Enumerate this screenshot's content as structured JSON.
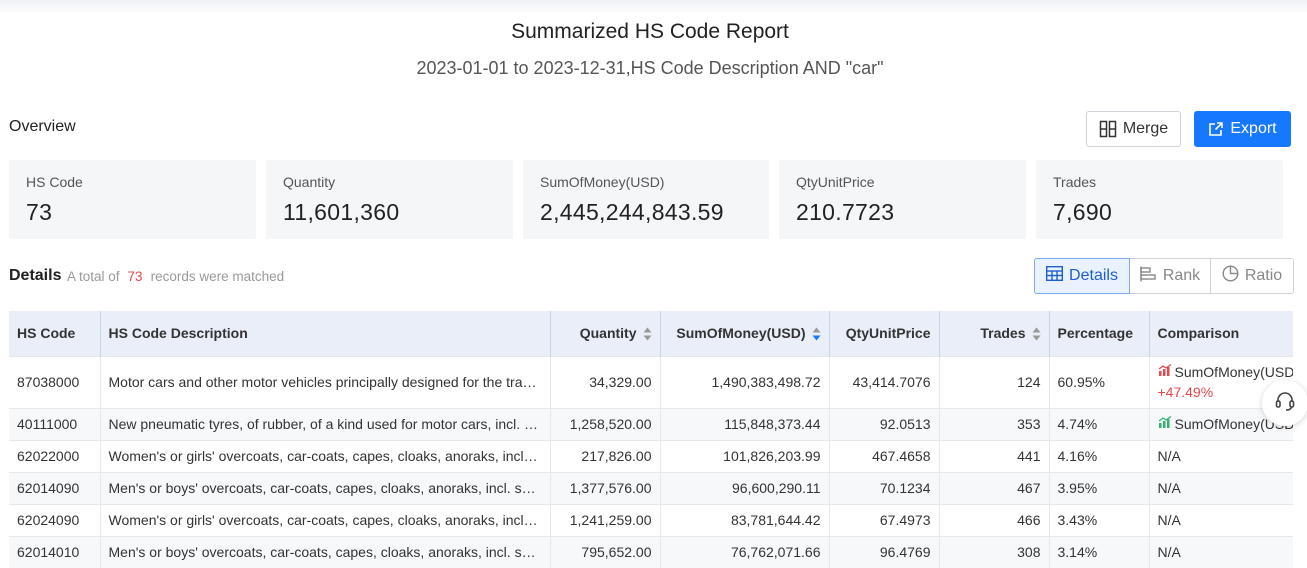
{
  "report": {
    "title": "Summarized HS Code Report",
    "subtitle": "2023-01-01 to 2023-12-31,HS Code Description AND \"car\""
  },
  "overview": {
    "label": "Overview",
    "merge_label": "Merge",
    "export_label": "Export",
    "stats": [
      {
        "label": "HS Code",
        "value": "73"
      },
      {
        "label": "Quantity",
        "value": "11,601,360"
      },
      {
        "label": "SumOfMoney(USD)",
        "value": "2,445,244,843.59"
      },
      {
        "label": "QtyUnitPrice",
        "value": "210.7723"
      },
      {
        "label": "Trades",
        "value": "7,690"
      }
    ]
  },
  "details": {
    "label": "Details",
    "total_prefix": "A total of",
    "total_count": "73",
    "total_suffix": "records were matched",
    "tabs": [
      {
        "label": "Details",
        "icon": "table-icon",
        "active": true
      },
      {
        "label": "Rank",
        "icon": "rank-bars-icon",
        "active": false
      },
      {
        "label": "Ratio",
        "icon": "pie-chart-icon",
        "active": false
      }
    ]
  },
  "table": {
    "headers": {
      "hs_code": "HS Code",
      "description": "HS Code Description",
      "quantity": "Quantity",
      "sum": "SumOfMoney(USD)",
      "unit_price": "QtyUnitPrice",
      "trades": "Trades",
      "percentage": "Percentage",
      "comparison": "Comparison"
    },
    "rows": [
      {
        "hs_code": "87038000",
        "description": "Motor cars and other motor vehicles principally designed for the transport of persons",
        "quantity": "34,329.00",
        "sum": "1,490,383,498.72",
        "unit_price": "43,414.7076",
        "trades": "124",
        "percentage": "60.95%",
        "comparison_label": "SumOfMoney(USD)",
        "comparison_change": "+47.49%"
      },
      {
        "hs_code": "40111000",
        "description": "New pneumatic tyres, of rubber, of a kind used for motor cars, incl. station wagons and racing cars",
        "quantity": "1,258,520.00",
        "sum": "115,848,373.44",
        "unit_price": "92.0513",
        "trades": "353",
        "percentage": "4.74%",
        "comparison_label": "SumOfMoney(USD)",
        "comparison_change": ""
      },
      {
        "hs_code": "62022000",
        "description": "Women's or girls' overcoats, car-coats, capes, cloaks, anoraks, incl. ski jackets",
        "quantity": "217,826.00",
        "sum": "101,826,203.99",
        "unit_price": "467.4658",
        "trades": "441",
        "percentage": "4.16%",
        "comparison_text": "N/A"
      },
      {
        "hs_code": "62014090",
        "description": "Men's or boys' overcoats, car-coats, capes, cloaks, anoraks, incl. ski jackets",
        "quantity": "1,377,576.00",
        "sum": "96,600,290.11",
        "unit_price": "70.1234",
        "trades": "467",
        "percentage": "3.95%",
        "comparison_text": "N/A"
      },
      {
        "hs_code": "62024090",
        "description": "Women's or girls' overcoats, car-coats, capes, cloaks, anoraks, incl. ski jackets",
        "quantity": "1,241,259.00",
        "sum": "83,781,644.42",
        "unit_price": "67.4973",
        "trades": "466",
        "percentage": "3.43%",
        "comparison_text": "N/A"
      },
      {
        "hs_code": "62014010",
        "description": "Men's or boys' overcoats, car-coats, capes, cloaks, anoraks, incl. ski jackets",
        "quantity": "795,652.00",
        "sum": "76,762,071.66",
        "unit_price": "96.4769",
        "trades": "308",
        "percentage": "3.14%",
        "comparison_text": "N/A"
      }
    ]
  },
  "colors": {
    "accent": "#1677ff",
    "header_bg": "#e9eef9",
    "card_bg": "#f5f6f8",
    "positive_change": "#e5484d",
    "trend_up_icon": "#e5484d",
    "trend_neutral_icon": "#2fb36d"
  }
}
